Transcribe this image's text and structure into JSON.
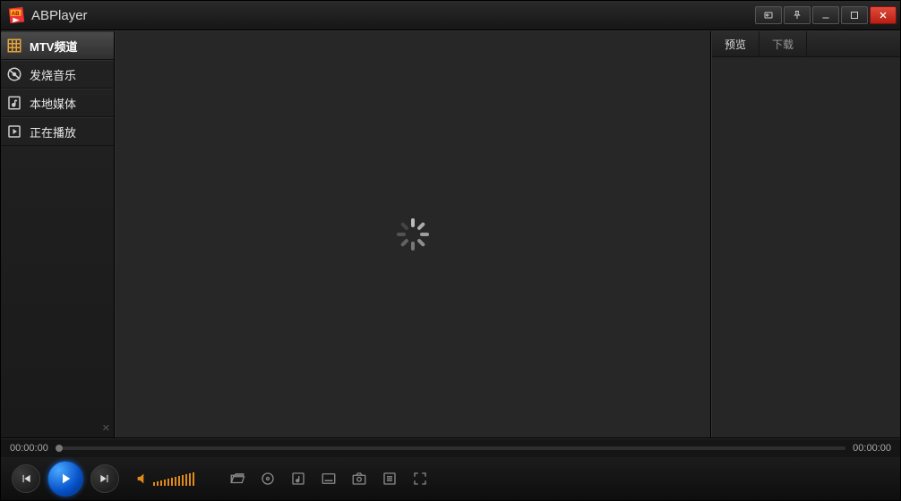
{
  "app": {
    "title": "ABPlayer"
  },
  "sidebar": {
    "items": [
      {
        "label": "MTV频道",
        "icon": "grid-icon",
        "active": true
      },
      {
        "label": "发烧音乐",
        "icon": "disc-icon",
        "active": false
      },
      {
        "label": "本地媒体",
        "icon": "music-file-icon",
        "active": false
      },
      {
        "label": "正在播放",
        "icon": "play-box-icon",
        "active": false
      }
    ]
  },
  "right_panel": {
    "tabs": [
      {
        "label": "预览",
        "active": true
      },
      {
        "label": "下载",
        "active": false
      }
    ]
  },
  "progress": {
    "current": "00:00:00",
    "total": "00:00:00"
  }
}
